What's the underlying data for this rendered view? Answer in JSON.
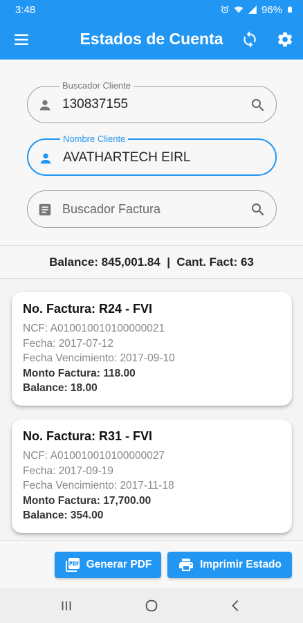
{
  "status": {
    "time": "3:48",
    "battery": "96%"
  },
  "appbar": {
    "title": "Estados de Cuenta"
  },
  "search": {
    "cliente": {
      "label": "Buscador Cliente",
      "value": "130837155"
    },
    "nombre": {
      "label": "Nombre Cliente",
      "value": "AVATHARTECH EIRL"
    },
    "factura": {
      "placeholder": "Buscador Factura"
    }
  },
  "summary": {
    "text": "Balance: 845,001.84  |  Cant. Fact: 63"
  },
  "invoices": [
    {
      "title": "No. Factura: R24 - FVI",
      "ncf": "NCF: A010010010100000021",
      "fecha": "Fecha: 2017-07-12",
      "vencimiento": "Fecha Vencimiento: 2017-09-10",
      "monto": "Monto Factura: 118.00",
      "balance": "Balance: 18.00"
    },
    {
      "title": "No. Factura: R31 - FVI",
      "ncf": "NCF: A010010010100000027",
      "fecha": "Fecha: 2017-09-19",
      "vencimiento": "Fecha Vencimiento: 2017-11-18",
      "monto": "Monto Factura: 17,700.00",
      "balance": "Balance: 354.00"
    }
  ],
  "actions": {
    "pdf_label": "Generar PDF",
    "print_label": "Imprimir Estado"
  },
  "colors": {
    "primary": "#2196f3",
    "background": "#f4f4f4"
  }
}
